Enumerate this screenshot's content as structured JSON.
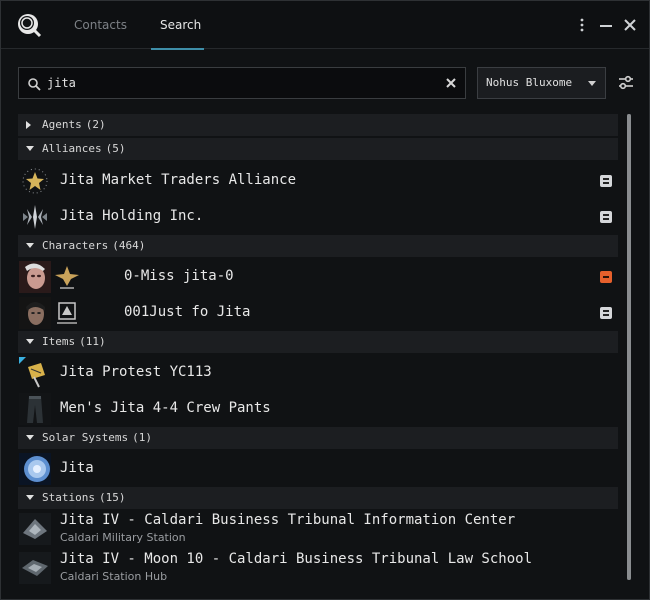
{
  "tabs": [
    {
      "label": "Contacts",
      "active": false
    },
    {
      "label": "Search",
      "active": true
    }
  ],
  "header": {
    "menu_icon": "kebab-menu-icon",
    "minimize_icon": "minimize-icon",
    "close_icon": "close-icon",
    "accent_color": "#3e8ea8"
  },
  "search": {
    "value": "jita",
    "placeholder": "",
    "icon": "search-icon",
    "clear_icon": "clear-icon"
  },
  "filter": {
    "selected": "Nohus Bluxome",
    "settings_icon": "sliders-icon"
  },
  "groups": [
    {
      "name": "Agents",
      "count": "(2)",
      "expanded": false
    },
    {
      "name": "Alliances",
      "count": "(5)",
      "expanded": true
    },
    {
      "name": "Characters",
      "count": "(464)",
      "expanded": true
    },
    {
      "name": "Items",
      "count": "(11)",
      "expanded": true
    },
    {
      "name": "Solar Systems",
      "count": "(1)",
      "expanded": true
    },
    {
      "name": "Stations",
      "count": "(15)",
      "expanded": true
    }
  ],
  "results": {
    "alliances": [
      {
        "title": "Jita Market Traders Alliance",
        "icon": "alliance-star-logo"
      },
      {
        "title": "Jita Holding Inc.",
        "icon": "alliance-blade-logo"
      }
    ],
    "characters": [
      {
        "title": "0-Miss jita-0",
        "standing": "negative",
        "standing_color": "#e6602c"
      },
      {
        "title": "001Just fo Jita",
        "standing": "neutral"
      }
    ],
    "items": [
      {
        "title": "Jita Protest YC113",
        "icon": "protest-sign-icon"
      },
      {
        "title": "Men's Jita 4-4 Crew Pants",
        "icon": "pants-icon"
      }
    ],
    "solar_systems": [
      {
        "title": "Jita",
        "icon": "sun-icon"
      }
    ],
    "stations": [
      {
        "title": "Jita IV - Caldari Business Tribunal Information Center",
        "subtitle": "Caldari Military Station",
        "icon": "station-icon"
      },
      {
        "title": "Jita IV - Moon 10 - Caldari Business Tribunal Law School",
        "subtitle": "Caldari Station Hub",
        "icon": "station-icon"
      }
    ]
  }
}
